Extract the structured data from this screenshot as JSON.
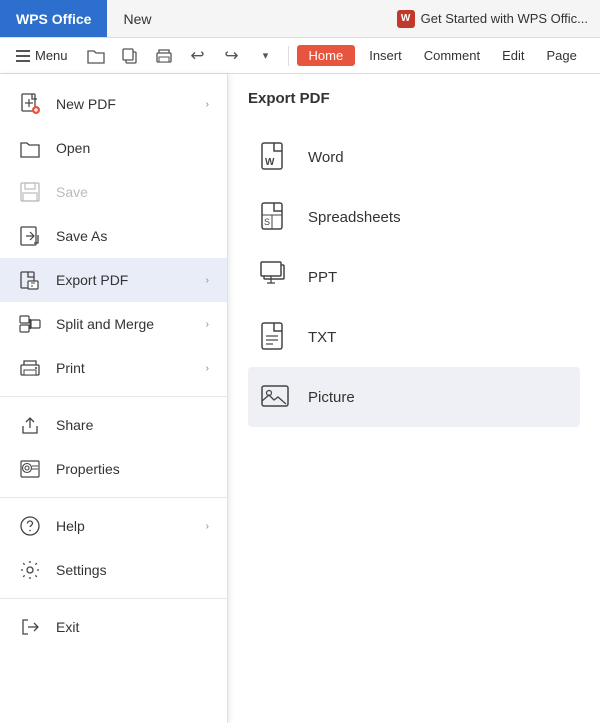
{
  "titlebar": {
    "wps_label": "WPS Office",
    "new_label": "New",
    "tab_label": "Get Started with WPS Offic..."
  },
  "toolbar": {
    "menu_label": "Menu",
    "home_label": "Home",
    "insert_label": "Insert",
    "comment_label": "Comment",
    "edit_label": "Edit",
    "page_label": "Page"
  },
  "left_menu": {
    "items": [
      {
        "id": "new-pdf",
        "label": "New PDF",
        "has_arrow": true,
        "disabled": false
      },
      {
        "id": "open",
        "label": "Open",
        "has_arrow": false,
        "disabled": false
      },
      {
        "id": "save",
        "label": "Save",
        "has_arrow": false,
        "disabled": true
      },
      {
        "id": "save-as",
        "label": "Save As",
        "has_arrow": false,
        "disabled": false
      },
      {
        "id": "export-pdf",
        "label": "Export PDF",
        "has_arrow": true,
        "disabled": false,
        "active": true
      },
      {
        "id": "split-and-merge",
        "label": "Split and Merge",
        "has_arrow": true,
        "disabled": false
      },
      {
        "id": "print",
        "label": "Print",
        "has_arrow": true,
        "disabled": false
      },
      {
        "id": "share",
        "label": "Share",
        "has_arrow": false,
        "disabled": false
      },
      {
        "id": "properties",
        "label": "Properties",
        "has_arrow": false,
        "disabled": false
      },
      {
        "id": "help",
        "label": "Help",
        "has_arrow": true,
        "disabled": false
      },
      {
        "id": "settings",
        "label": "Settings",
        "has_arrow": false,
        "disabled": false
      },
      {
        "id": "exit",
        "label": "Exit",
        "has_arrow": false,
        "disabled": false
      }
    ]
  },
  "submenu": {
    "title": "Export PDF",
    "items": [
      {
        "id": "word",
        "label": "Word",
        "highlighted": false
      },
      {
        "id": "spreadsheets",
        "label": "Spreadsheets",
        "highlighted": false
      },
      {
        "id": "ppt",
        "label": "PPT",
        "highlighted": false
      },
      {
        "id": "txt",
        "label": "TXT",
        "highlighted": false
      },
      {
        "id": "picture",
        "label": "Picture",
        "highlighted": true
      }
    ]
  }
}
